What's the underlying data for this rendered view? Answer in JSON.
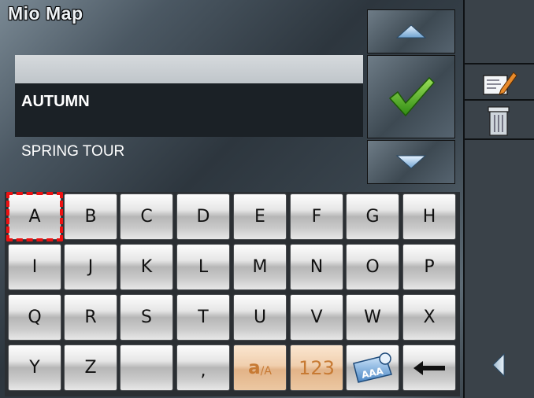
{
  "app": {
    "title": "Mio Map"
  },
  "list": {
    "items": [
      {
        "label": ""
      },
      {
        "label": "AUTUMN",
        "selected": true
      },
      {
        "label": "SPRING TOUR"
      }
    ]
  },
  "side_buttons": {
    "up": "up-arrow-icon",
    "ok": "checkmark-icon",
    "down": "down-arrow-icon"
  },
  "keyboard": {
    "row1": [
      "A",
      "B",
      "C",
      "D",
      "E",
      "F",
      "G",
      "H"
    ],
    "row2": [
      "I",
      "J",
      "K",
      "L",
      "M",
      "N",
      "O",
      "P"
    ],
    "row3": [
      "Q",
      "R",
      "S",
      "T",
      "U",
      "V",
      "W",
      "X"
    ],
    "row4": [
      "Y",
      "Z",
      "",
      ","
    ],
    "case_key": {
      "main": "a",
      "sub": "/A"
    },
    "numeric_key": "123",
    "layout_key": "AAA",
    "backspace": "backspace-arrow-icon"
  },
  "toolbar": {
    "items": [
      "edit-icon",
      "trash-icon"
    ],
    "back": "back-arrow-icon"
  },
  "colors": {
    "highlight_key": "#f0cfae",
    "selection_outline": "#ee1111",
    "check_green": "#4caf1a"
  }
}
